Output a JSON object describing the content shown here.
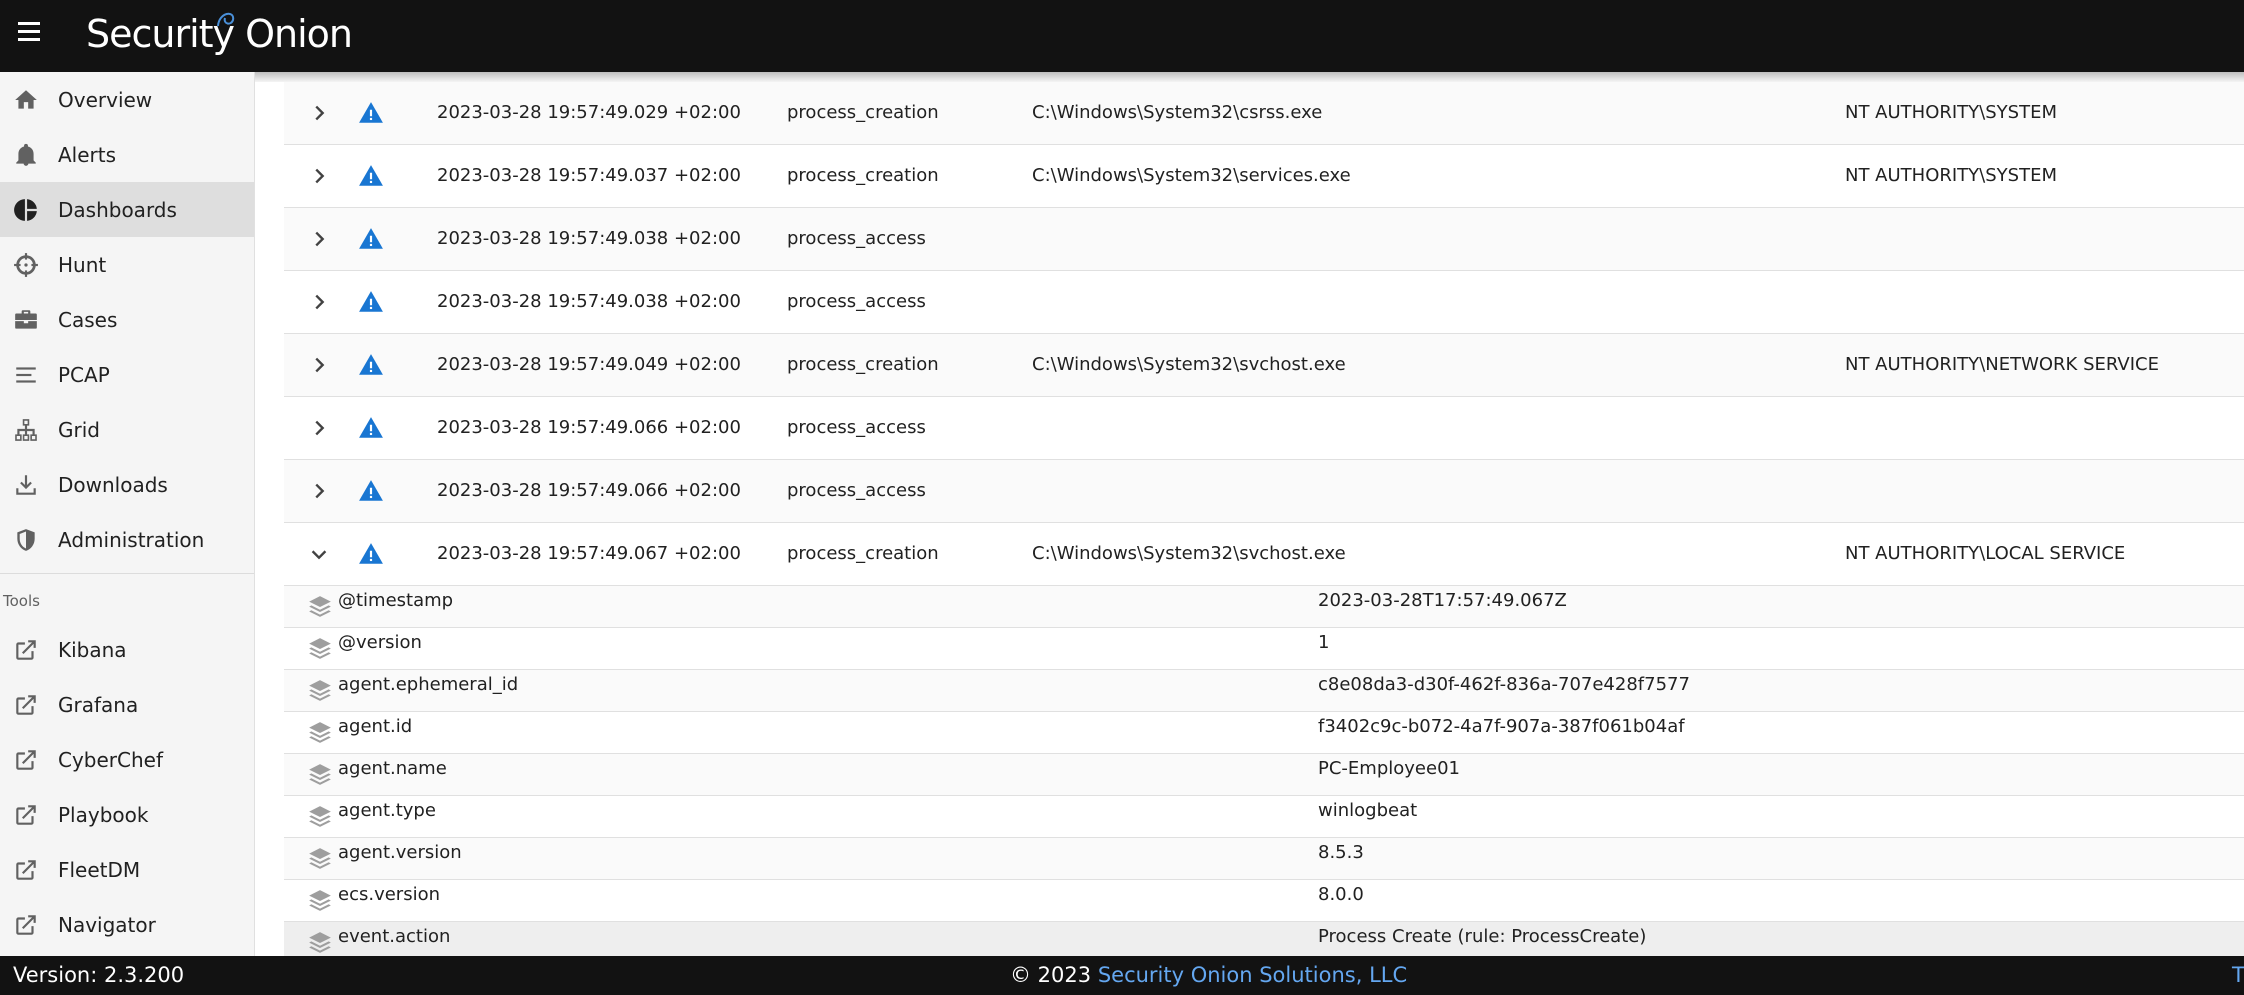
{
  "app": {
    "logo_text": "Security Onion"
  },
  "nav": {
    "items": [
      {
        "label": "Overview",
        "icon": "home-icon"
      },
      {
        "label": "Alerts",
        "icon": "bell-icon"
      },
      {
        "label": "Dashboards",
        "icon": "pie-chart-icon",
        "active": true
      },
      {
        "label": "Hunt",
        "icon": "crosshairs-icon"
      },
      {
        "label": "Cases",
        "icon": "briefcase-icon"
      },
      {
        "label": "PCAP",
        "icon": "lines-icon"
      },
      {
        "label": "Grid",
        "icon": "network-icon"
      },
      {
        "label": "Downloads",
        "icon": "download-icon"
      },
      {
        "label": "Administration",
        "icon": "shield-icon"
      }
    ],
    "tools_label": "Tools",
    "tools": [
      {
        "label": "Kibana",
        "icon": "external-link-icon"
      },
      {
        "label": "Grafana",
        "icon": "external-link-icon"
      },
      {
        "label": "CyberChef",
        "icon": "external-link-icon"
      },
      {
        "label": "Playbook",
        "icon": "external-link-icon"
      },
      {
        "label": "FleetDM",
        "icon": "external-link-icon"
      },
      {
        "label": "Navigator",
        "icon": "external-link-icon"
      }
    ]
  },
  "events": [
    {
      "time": "2023-03-28 19:57:49.029 +02:00",
      "type": "process_creation",
      "path": "C:\\Windows\\System32\\csrss.exe",
      "user": "NT AUTHORITY\\SYSTEM",
      "expanded": false
    },
    {
      "time": "2023-03-28 19:57:49.037 +02:00",
      "type": "process_creation",
      "path": "C:\\Windows\\System32\\services.exe",
      "user": "NT AUTHORITY\\SYSTEM",
      "expanded": false
    },
    {
      "time": "2023-03-28 19:57:49.038 +02:00",
      "type": "process_access",
      "path": "",
      "user": "",
      "expanded": false
    },
    {
      "time": "2023-03-28 19:57:49.038 +02:00",
      "type": "process_access",
      "path": "",
      "user": "",
      "expanded": false
    },
    {
      "time": "2023-03-28 19:57:49.049 +02:00",
      "type": "process_creation",
      "path": "C:\\Windows\\System32\\svchost.exe",
      "user": "NT AUTHORITY\\NETWORK SERVICE",
      "expanded": false
    },
    {
      "time": "2023-03-28 19:57:49.066 +02:00",
      "type": "process_access",
      "path": "",
      "user": "",
      "expanded": false
    },
    {
      "time": "2023-03-28 19:57:49.066 +02:00",
      "type": "process_access",
      "path": "",
      "user": "",
      "expanded": false
    },
    {
      "time": "2023-03-28 19:57:49.067 +02:00",
      "type": "process_creation",
      "path": "C:\\Windows\\System32\\svchost.exe",
      "user": "NT AUTHORITY\\LOCAL SERVICE",
      "expanded": true
    }
  ],
  "details": [
    {
      "key": "@timestamp",
      "value": "2023-03-28T17:57:49.067Z"
    },
    {
      "key": "@version",
      "value": "1"
    },
    {
      "key": "agent.ephemeral_id",
      "value": "c8e08da3-d30f-462f-836a-707e428f7577"
    },
    {
      "key": "agent.id",
      "value": "f3402c9c-b072-4a7f-907a-387f061b04af"
    },
    {
      "key": "agent.name",
      "value": "PC-Employee01"
    },
    {
      "key": "agent.type",
      "value": "winlogbeat"
    },
    {
      "key": "agent.version",
      "value": "8.5.3"
    },
    {
      "key": "ecs.version",
      "value": "8.0.0"
    },
    {
      "key": "event.action",
      "value": "Process Create (rule: ProcessCreate)",
      "highlight": true
    }
  ],
  "footer": {
    "version": "Version: 2.3.200",
    "copyright": "© 2023",
    "company": "Security Onion Solutions, LLC",
    "edge_link": "T"
  },
  "colors": {
    "topbar": "#121212",
    "alert_icon": "#1976d2",
    "link": "#64a7f0"
  }
}
